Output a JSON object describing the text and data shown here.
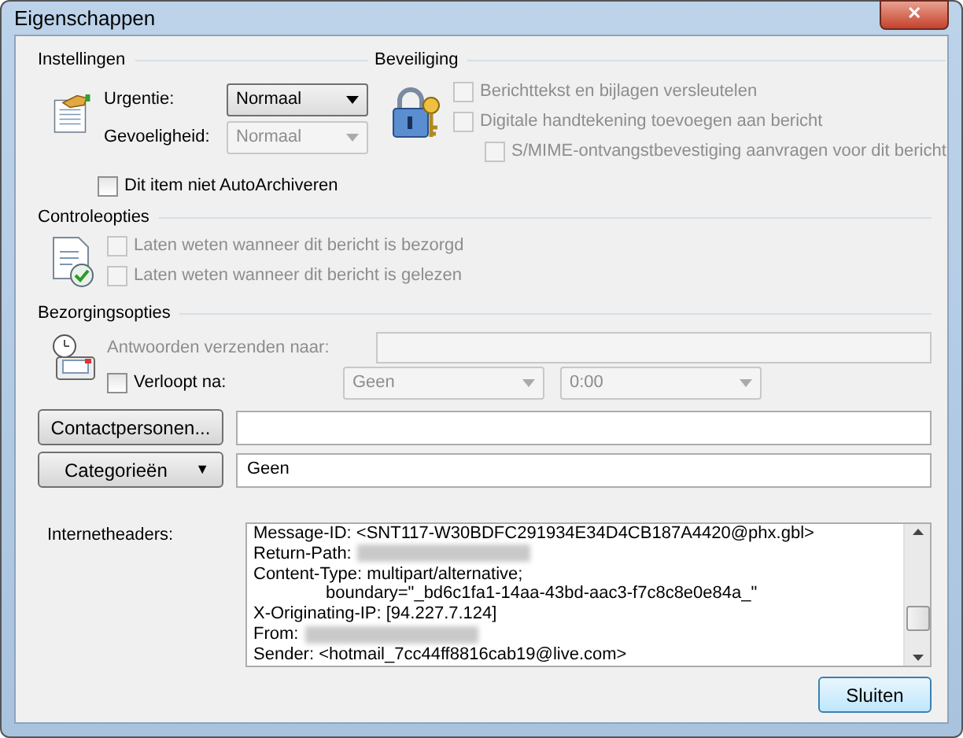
{
  "window": {
    "title": "Eigenschappen",
    "close": "✕"
  },
  "settings": {
    "title": "Instellingen",
    "urgency": {
      "label": "Urgentie:",
      "value": "Normaal",
      "disabled": false
    },
    "sensitivity": {
      "label": "Gevoeligheid:",
      "value": "Normaal",
      "disabled": true
    },
    "autoarchive": {
      "label": "Dit item niet AutoArchiveren",
      "checked": false,
      "disabled": false
    }
  },
  "security": {
    "title": "Beveiliging",
    "options": [
      {
        "label": "Berichttekst en bijlagen versleutelen",
        "checked": false,
        "disabled": true
      },
      {
        "label": "Digitale handtekening toevoegen aan bericht",
        "checked": false,
        "disabled": true,
        "children": [
          {
            "label": "S/MIME-ontvangstbevestiging aanvragen voor dit bericht",
            "checked": false,
            "disabled": true
          }
        ]
      }
    ]
  },
  "tracking": {
    "title": "Controleopties",
    "options": [
      {
        "label": "Laten weten wanneer dit bericht is bezorgd",
        "checked": false,
        "disabled": true
      },
      {
        "label": "Laten weten wanneer dit bericht is gelezen",
        "checked": false,
        "disabled": true
      }
    ]
  },
  "delivery": {
    "title": "Bezorgingsopties",
    "reply_to": {
      "label": "Antwoorden verzenden naar:",
      "disabled": true
    },
    "expires": {
      "label": "Verloopt na:",
      "checked": false,
      "disabled": false,
      "date": {
        "value": "Geen",
        "disabled": true
      },
      "time": {
        "value": "0:00",
        "disabled": true
      }
    }
  },
  "contacts": {
    "button": "Contactpersonen..."
  },
  "categories": {
    "button": "Categorieën",
    "caret": "▼",
    "value": "Geen"
  },
  "headers": {
    "label": "Internetheaders:",
    "lines": [
      {
        "text": "Message-ID: <SNT117-W30BDFC291934E34D4CB187A4420@phx.gbl>",
        "indent": false,
        "redacted": false
      },
      {
        "text": "Return-Path:",
        "indent": false,
        "redacted": true
      },
      {
        "text": "Content-Type: multipart/alternative;",
        "indent": false,
        "redacted": false
      },
      {
        "text": "boundary=\"_bd6c1fa1-14aa-43bd-aac3-f7c8c8e0e84a_\"",
        "indent": true,
        "redacted": false
      },
      {
        "text": "X-Originating-IP: [94.227.7.124]",
        "indent": false,
        "redacted": false
      },
      {
        "text": "From:",
        "indent": false,
        "redacted": true
      },
      {
        "text": "Sender: <hotmail_7cc44ff8816cab19@live.com>",
        "indent": false,
        "redacted": false
      }
    ]
  },
  "footer": {
    "button": "Sluiten"
  }
}
